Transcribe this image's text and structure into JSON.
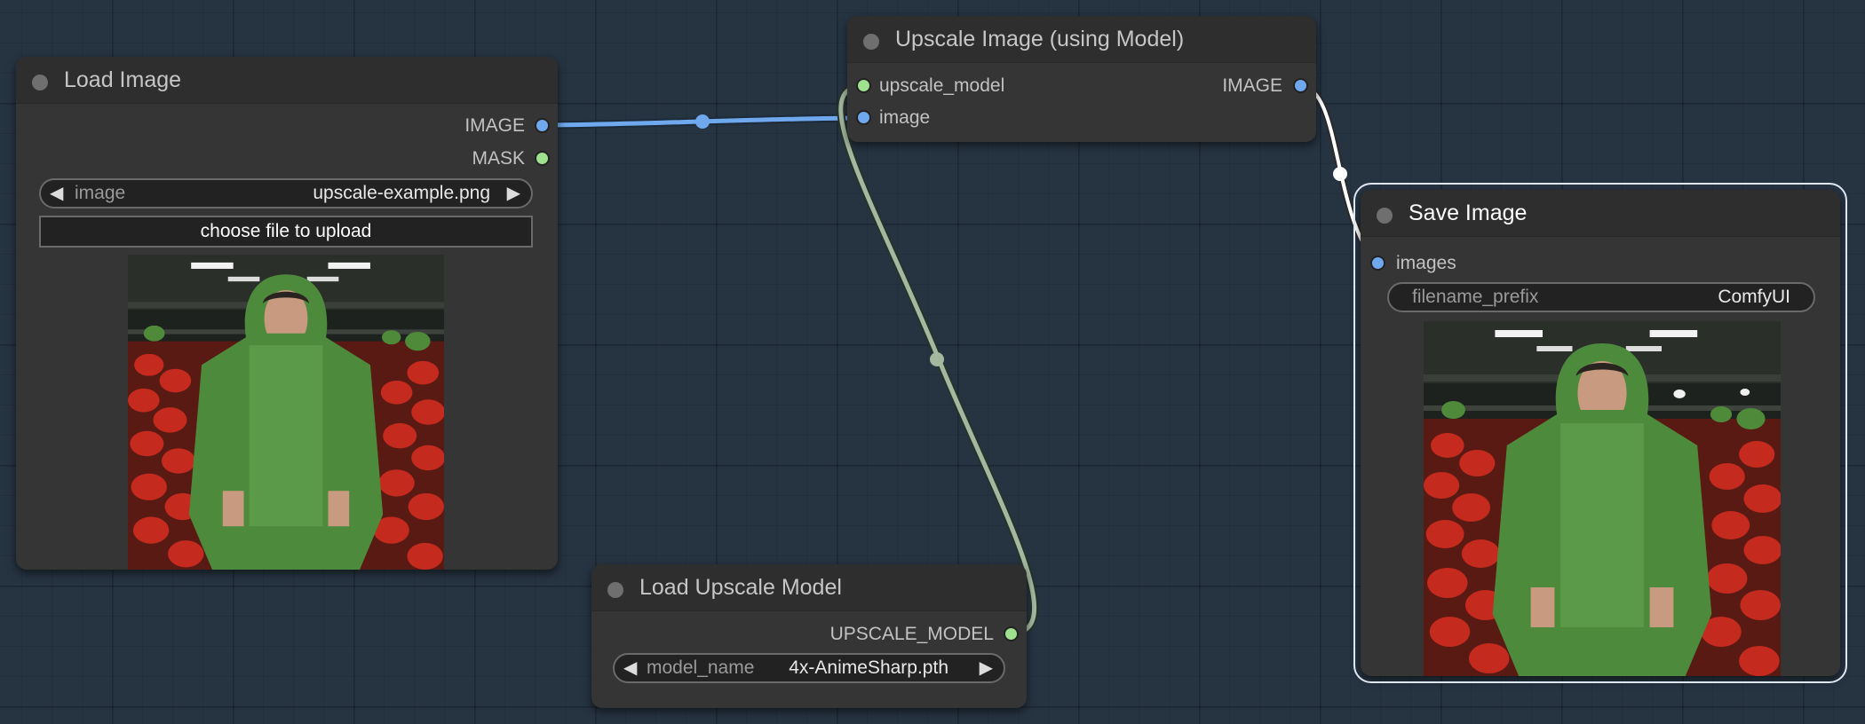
{
  "canvas": {
    "background": "#263341"
  },
  "nodes": {
    "load_image": {
      "title": "Load Image",
      "outputs": [
        {
          "label": "IMAGE",
          "color": "#6fa8ec"
        },
        {
          "label": "MASK",
          "color": "#9ee28f"
        }
      ],
      "widget_image": {
        "name": "image",
        "value": "upscale-example.png"
      },
      "upload_label": "choose file to upload",
      "preview_icon": "image-preview-man-green-hoodie"
    },
    "upscale_image": {
      "title": "Upscale Image (using Model)",
      "inputs": [
        {
          "label": "upscale_model",
          "color": "#9ee28f"
        },
        {
          "label": "image",
          "color": "#6fa8ec"
        }
      ],
      "outputs": [
        {
          "label": "IMAGE",
          "color": "#6fa8ec"
        }
      ]
    },
    "save_image": {
      "title": "Save Image",
      "inputs": [
        {
          "label": "images",
          "color": "#6fa8ec"
        }
      ],
      "widget_prefix": {
        "name": "filename_prefix",
        "value": "ComfyUI"
      },
      "preview_icon": "image-preview-man-green-hoodie"
    },
    "load_upscale_model": {
      "title": "Load Upscale Model",
      "outputs": [
        {
          "label": "UPSCALE_MODEL",
          "color": "#9ee28f"
        }
      ],
      "widget_model": {
        "name": "model_name",
        "value": "4x-AnimeSharp.pth"
      }
    }
  },
  "links": [
    {
      "from": "Load Image.IMAGE",
      "to": "Upscale Image (using Model).image",
      "color": "#6fa8ec"
    },
    {
      "from": "Load Upscale Model.UPSCALE_MODEL",
      "to": "Upscale Image (using Model).upscale_model",
      "color": "#9fb49c"
    },
    {
      "from": "Upscale Image (using Model).IMAGE",
      "to": "Save Image.images",
      "color": "#ffffff"
    }
  ]
}
